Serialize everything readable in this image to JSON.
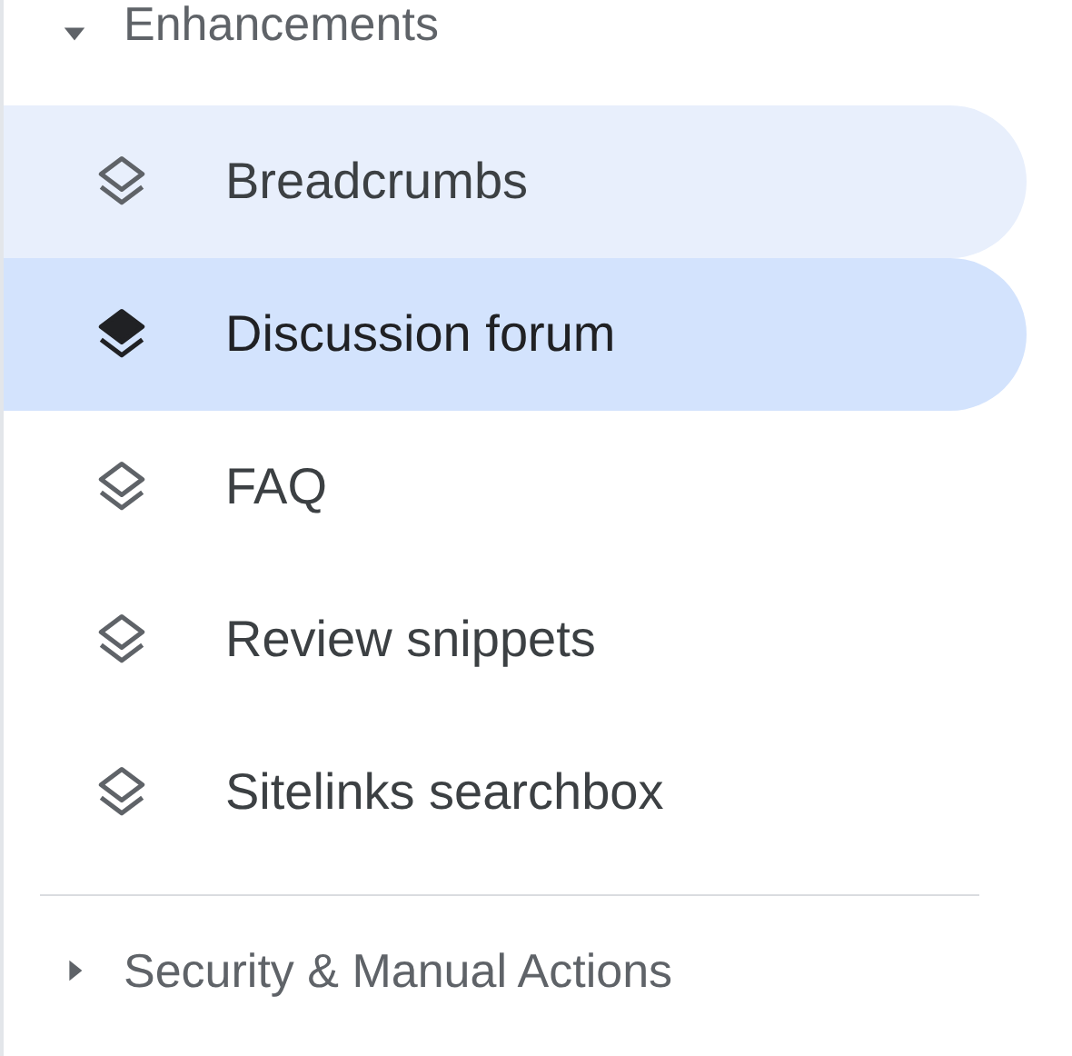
{
  "section": {
    "title": "Enhancements",
    "expanded": true
  },
  "items": [
    {
      "label": "Breadcrumbs",
      "selected": false,
      "hovered": true
    },
    {
      "label": "Discussion forum",
      "selected": true,
      "hovered": false
    },
    {
      "label": "FAQ",
      "selected": false,
      "hovered": false
    },
    {
      "label": "Review snippets",
      "selected": false,
      "hovered": false
    },
    {
      "label": "Sitelinks searchbox",
      "selected": false,
      "hovered": false
    }
  ],
  "next_section": {
    "title": "Security & Manual Actions",
    "expanded": false
  }
}
